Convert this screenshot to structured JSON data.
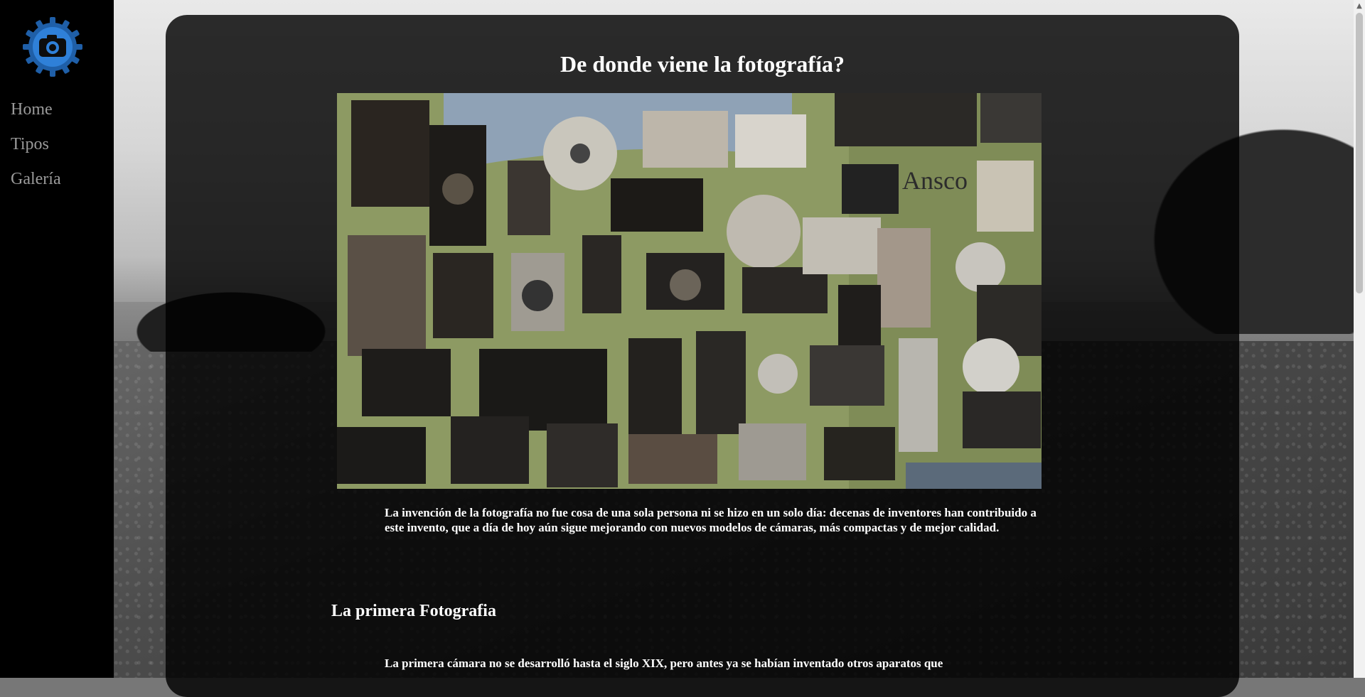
{
  "sidebar": {
    "logo_icon": "camera-gear-icon",
    "nav": [
      {
        "label": "Home"
      },
      {
        "label": "Tipos"
      },
      {
        "label": "Galería"
      }
    ]
  },
  "main": {
    "title": "De donde viene la fotografía?",
    "photo_icon": "vintage-cameras-collage",
    "photo_brand_text": "Ansco",
    "intro": "La invención de la fotografía no fue cosa de una sola persona ni se hizo en un solo día: decenas de inventores han contribuido a este invento, que a día de hoy aún sigue mejorando con nuevos modelos de cámaras, más compactas y de mejor calidad.",
    "section_heading": "La primera Fotografia",
    "section_text": "La primera cámara no se desarrolló hasta el siglo XIX, pero antes ya se habían inventado otros aparatos que"
  },
  "colors": {
    "sidebar_bg": "#000000",
    "nav_text": "#9a9a9a",
    "logo_blue": "#2f80d8",
    "card_bg": "rgba(0,0,0,0.82)"
  }
}
